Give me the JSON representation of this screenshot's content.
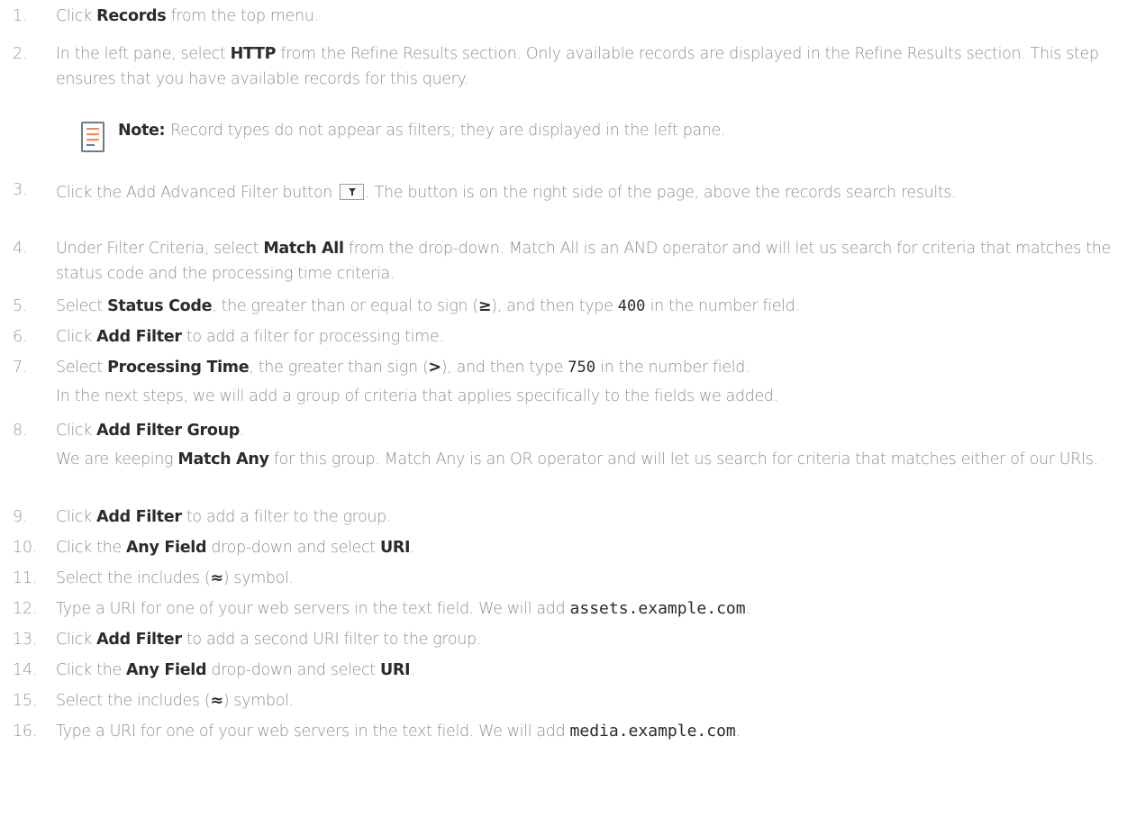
{
  "steps": [
    {
      "num": "1.",
      "pre": "Click ",
      "b1": "Records",
      "post": " from the top menu."
    },
    {
      "num": "2.",
      "pre": "In the left pane, select ",
      "b1": "HTTP",
      "post": " from the Refine Results section. Only available records are displayed in the Refine Results section. This step ensures that you have available records for this query."
    },
    {
      "num": "3.",
      "pre": "Click the Add Advanced Filter button ",
      "post": ". The button is on the right side of the page, above the records search results."
    },
    {
      "num": "4.",
      "pre": "Under Filter Criteria, select ",
      "b1": "Match All",
      "post": " from the drop-down. Match All is an AND operator and will let us search for criteria that matches the status code and the processing time criteria."
    },
    {
      "num": "5.",
      "pre": "Select ",
      "b1": "Status Code",
      "mid": ", the greater than or equal to sign (",
      "sym": "≥",
      "mid2": "), and then type ",
      "code": "400",
      "post": " in the number field."
    },
    {
      "num": "6.",
      "pre": "Click ",
      "b1": "Add Filter",
      "post": " to add a filter for processing time."
    },
    {
      "num": "7.",
      "pre": "Select ",
      "b1": "Processing Time",
      "mid": ", the greater than sign (",
      "sym": ">",
      "mid2": "), and then type ",
      "code": "750",
      "post": " in the number field.",
      "sub": "In the next steps, we will add a group of criteria that applies specifically to the fields we added."
    },
    {
      "num": "8.",
      "pre": "Click ",
      "b1": "Add Filter Group",
      "post": ".",
      "sub_pre": "We are keeping ",
      "sub_b": "Match Any",
      "sub_post": " for this group. Match Any is an OR operator and will let us search for criteria that matches either of our URIs."
    },
    {
      "num": "9.",
      "pre": "Click ",
      "b1": "Add Filter",
      "post": " to add a filter to the group."
    },
    {
      "num": "10.",
      "pre": "Click the ",
      "b1": "Any Field",
      "mid": " drop-down and select ",
      "b2": "URI",
      "post": "."
    },
    {
      "num": "11.",
      "pre": "Select the includes (",
      "sym": "≈",
      "post": ") symbol."
    },
    {
      "num": "12.",
      "pre": "Type a URI for one of your web servers in the text field. We will add ",
      "code": "assets.example.com",
      "post": "."
    },
    {
      "num": "13.",
      "pre": "Click ",
      "b1": "Add Filter",
      "post": " to add a second URI filter to the group."
    },
    {
      "num": "14.",
      "pre": "Click the ",
      "b1": "Any Field",
      "mid": " drop-down and select ",
      "b2": "URI",
      "post": "."
    },
    {
      "num": "15.",
      "pre": "Select the includes (",
      "sym": "≈",
      "post": ") symbol."
    },
    {
      "num": "16.",
      "pre": "Type a URI for one of your web servers in the text field. We will add ",
      "code": "media.example.com",
      "post": "."
    }
  ],
  "note": {
    "label": "Note:",
    "text": "Record types do not appear as filters; they are displayed in the left pane.",
    "icon": "note-icon",
    "icon_colors": [
      "#f08a5d",
      "#f08a5d",
      "#6a7e8a"
    ]
  },
  "filter_button_icon": "filter-icon"
}
